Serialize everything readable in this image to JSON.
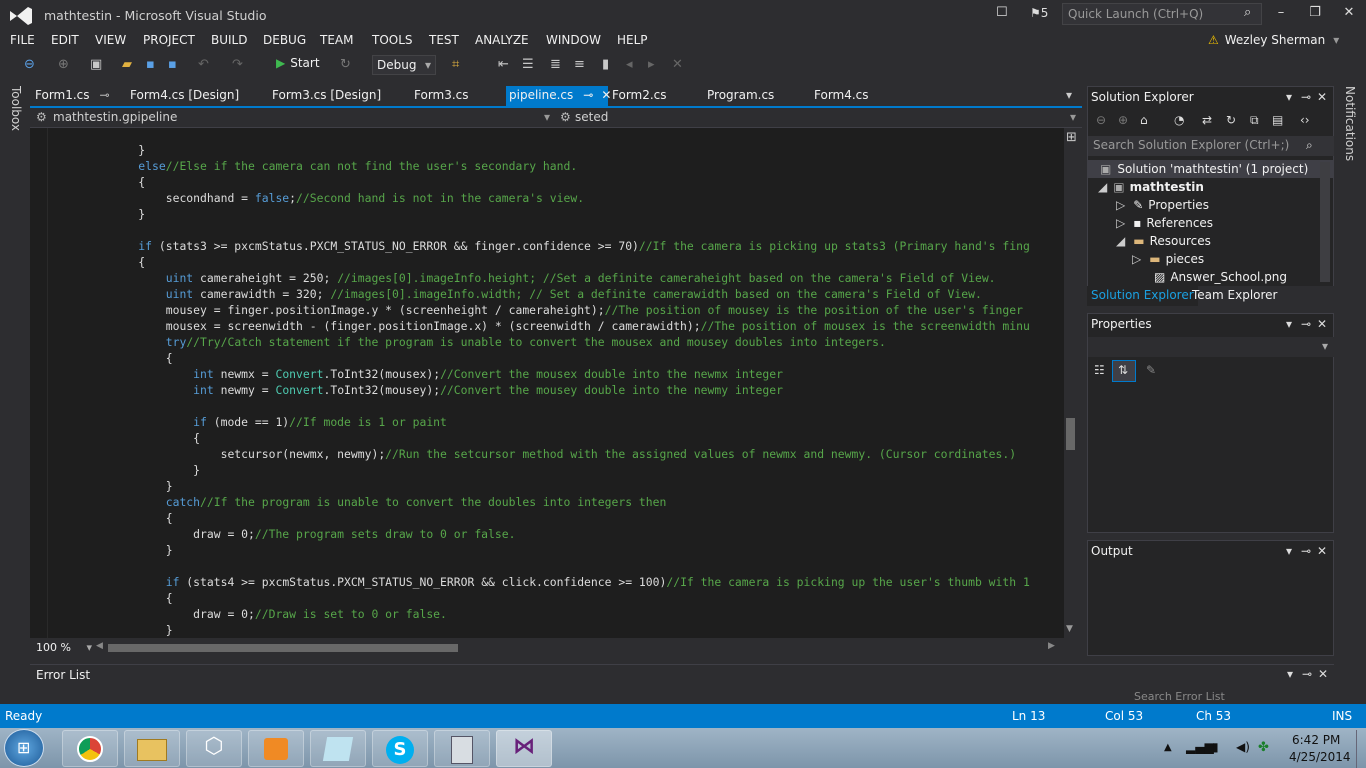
{
  "window": {
    "title": "mathtestin - Microsoft Visual Studio",
    "notif_count": "5",
    "quick_launch": "Quick Launch (Ctrl+Q)",
    "user": "Wezley Sherman"
  },
  "menu": [
    "FILE",
    "EDIT",
    "VIEW",
    "PROJECT",
    "BUILD",
    "DEBUG",
    "TEAM",
    "TOOLS",
    "TEST",
    "ANALYZE",
    "WINDOW",
    "HELP"
  ],
  "toolbar": {
    "start_label": "Start",
    "config": "Debug"
  },
  "side": {
    "toolbox": "Toolbox",
    "notifications": "Notifications"
  },
  "tabs": [
    "Form1.cs",
    "Form4.cs [Design]",
    "Form3.cs [Design]",
    "Form3.cs",
    "pipeline.cs",
    "Form2.cs",
    "Program.cs",
    "Form4.cs"
  ],
  "nav": {
    "left": "mathtestin.gpipeline",
    "right": "seted"
  },
  "code": [
    [
      {
        "t": "            }"
      }
    ],
    [
      {
        "t": "            "
      },
      {
        "k": "else"
      },
      {
        "c": "//Else if the camera can not find the user's secondary hand."
      }
    ],
    [
      {
        "t": "            {"
      }
    ],
    [
      {
        "t": "                secondhand = "
      },
      {
        "k": "false"
      },
      {
        "t": ";"
      },
      {
        "c": "//Second hand is not in the camera's view."
      }
    ],
    [
      {
        "t": "            }"
      }
    ],
    [
      {
        "t": ""
      }
    ],
    [
      {
        "t": "            "
      },
      {
        "k": "if"
      },
      {
        "t": " (stats3 >= pxcmStatus.PXCM_STATUS_NO_ERROR && finger.confidence >= 70)"
      },
      {
        "c": "//If the camera is picking up stats3 (Primary hand's fing"
      }
    ],
    [
      {
        "t": "            {"
      }
    ],
    [
      {
        "t": "                "
      },
      {
        "k": "uint"
      },
      {
        "t": " cameraheight = 250; "
      },
      {
        "c": "//images[0].imageInfo.height; //Set a definite cameraheight based on the camera's Field of View."
      }
    ],
    [
      {
        "t": "                "
      },
      {
        "k": "uint"
      },
      {
        "t": " camerawidth = 320; "
      },
      {
        "c": "//images[0].imageInfo.width; // Set a definite camerawidth based on the camera's Field of View."
      }
    ],
    [
      {
        "t": "                mousey = finger.positionImage.y * (screenheight / cameraheight);"
      },
      {
        "c": "//The position of mousey is the position of the user's finger"
      }
    ],
    [
      {
        "t": "                mousex = screenwidth - (finger.positionImage.x) * (screenwidth / camerawidth);"
      },
      {
        "c": "//The position of mousex is the screenwidth minu"
      }
    ],
    [
      {
        "t": "                "
      },
      {
        "k": "try"
      },
      {
        "c": "//Try/Catch statement if the program is unable to convert the mousex and mousey doubles into integers."
      }
    ],
    [
      {
        "t": "                {"
      }
    ],
    [
      {
        "t": "                    "
      },
      {
        "k": "int"
      },
      {
        "t": " newmx = "
      },
      {
        "ty": "Convert"
      },
      {
        "t": ".ToInt32(mousex);"
      },
      {
        "c": "//Convert the mousex double into the newmx integer"
      }
    ],
    [
      {
        "t": "                    "
      },
      {
        "k": "int"
      },
      {
        "t": " newmy = "
      },
      {
        "ty": "Convert"
      },
      {
        "t": ".ToInt32(mousey);"
      },
      {
        "c": "//Convert the mousey double into the newmy integer"
      }
    ],
    [
      {
        "t": ""
      }
    ],
    [
      {
        "t": "                    "
      },
      {
        "k": "if"
      },
      {
        "t": " (mode == 1)"
      },
      {
        "c": "//If mode is 1 or paint"
      }
    ],
    [
      {
        "t": "                    {"
      }
    ],
    [
      {
        "t": "                        setcursor(newmx, newmy);"
      },
      {
        "c": "//Run the setcursor method with the assigned values of newmx and newmy. (Cursor cordinates.)"
      }
    ],
    [
      {
        "t": "                    }"
      }
    ],
    [
      {
        "t": "                }"
      }
    ],
    [
      {
        "t": "                "
      },
      {
        "k": "catch"
      },
      {
        "c": "//If the program is unable to convert the doubles into integers then"
      }
    ],
    [
      {
        "t": "                {"
      }
    ],
    [
      {
        "t": "                    draw = 0;"
      },
      {
        "c": "//The program sets draw to 0 or false."
      }
    ],
    [
      {
        "t": "                }"
      }
    ],
    [
      {
        "t": ""
      }
    ],
    [
      {
        "t": "                "
      },
      {
        "k": "if"
      },
      {
        "t": " (stats4 >= pxcmStatus.PXCM_STATUS_NO_ERROR && click.confidence >= 100)"
      },
      {
        "c": "//If the camera is picking up the user's thumb with 1"
      }
    ],
    [
      {
        "t": "                {"
      }
    ],
    [
      {
        "t": "                    draw = 0;"
      },
      {
        "c": "//Draw is set to 0 or false."
      }
    ],
    [
      {
        "t": "                }"
      }
    ]
  ],
  "zoom": "100 %",
  "error_list": {
    "title": "Error List",
    "search": "Search Error List"
  },
  "solution_explorer": {
    "title": "Solution Explorer",
    "search": "Search Solution Explorer (Ctrl+;)",
    "items": [
      "Solution 'mathtestin' (1 project)",
      "mathtestin",
      "Properties",
      "References",
      "Resources",
      "pieces",
      "Answer_School.png"
    ],
    "tabs": [
      "Solution Explorer",
      "Team Explorer"
    ]
  },
  "properties": {
    "title": "Properties"
  },
  "output": {
    "title": "Output"
  },
  "status": {
    "ready": "Ready",
    "ln": "Ln 13",
    "col": "Col 53",
    "ch": "Ch 53",
    "ins": "INS"
  },
  "clock": {
    "time": "6:42 PM",
    "date": "4/25/2014"
  }
}
